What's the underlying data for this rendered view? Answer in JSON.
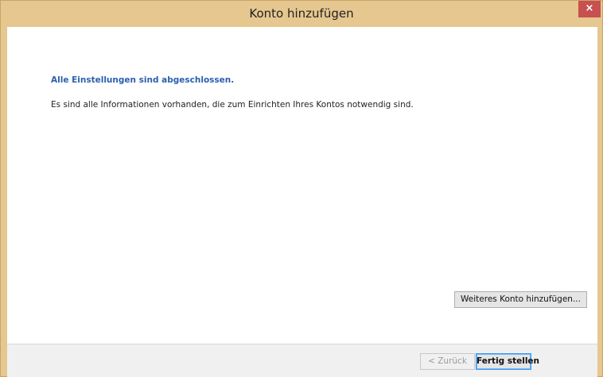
{
  "window": {
    "title": "Konto hinzufügen",
    "close_label": "×"
  },
  "content": {
    "heading": "Alle Einstellungen sind abgeschlossen.",
    "description": "Es sind alle Informationen vorhanden, die zum Einrichten Ihres Kontos notwendig sind.",
    "add_account_label": "Weiteres Konto hinzufügen..."
  },
  "footer": {
    "back_label": "< Zurück",
    "finish_label": "Fertig stellen"
  },
  "colors": {
    "frame": "#e6c78f",
    "heading": "#2b5fae",
    "close": "#c75050"
  }
}
